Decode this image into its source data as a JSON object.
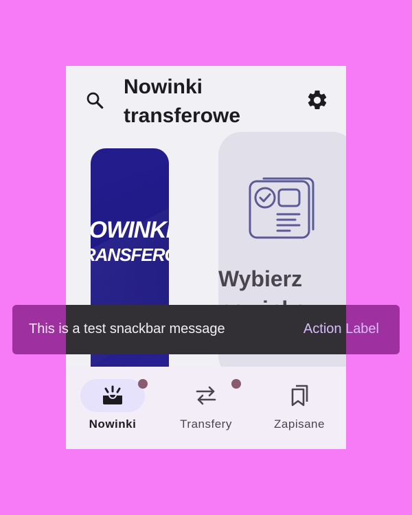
{
  "header": {
    "title": "Nowinki transferowe",
    "search_icon": "search-icon",
    "settings_icon": "gear-icon"
  },
  "cards": {
    "logo": {
      "line1": "NOWINKI",
      "line2": "TRANSFEROWE",
      "background": "#231c8e"
    },
    "choose": {
      "icon": "document-check-icon",
      "title": "Wybierz nowinkę"
    }
  },
  "nav": {
    "items": [
      {
        "label": "Nowinki",
        "icon": "inbox-new-icon",
        "active": true,
        "badge": true
      },
      {
        "label": "Transfery",
        "icon": "swap-arrows-icon",
        "active": false,
        "badge": true
      },
      {
        "label": "Zapisane",
        "icon": "bookmarks-icon",
        "active": false,
        "badge": false
      }
    ]
  },
  "snackbar": {
    "message": "This is a test snackbar message",
    "action": "Action Label"
  },
  "colors": {
    "background": "#f77bf7",
    "surface": "#f1f0f4",
    "accent": "#e7e2fc",
    "snackbar": "#323035",
    "snackbar_action": "#d8bdfa"
  }
}
